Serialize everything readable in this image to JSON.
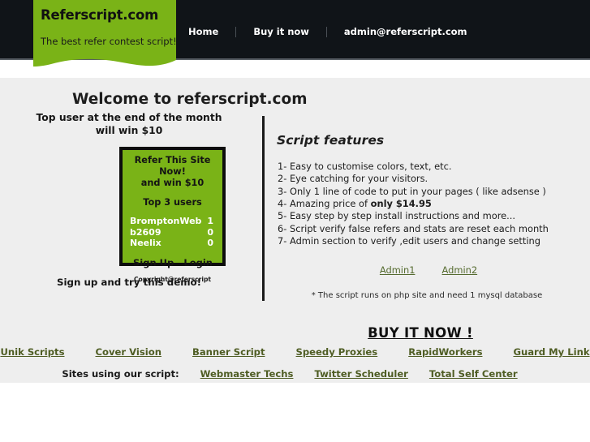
{
  "header": {
    "brand_title": "Referscript.com",
    "brand_tagline": "The best refer contest script!",
    "brand_color": "#7ab317",
    "bar_color": "#101418",
    "nav": [
      {
        "label": "Home"
      },
      {
        "label": "Buy it now"
      },
      {
        "label": "admin@referscript.com"
      }
    ]
  },
  "main": {
    "page_title": "Welcome to referscript.com",
    "left": {
      "promo_line1": "Top user at the end of the month",
      "promo_line2": "will win $10",
      "widget": {
        "title_line1": "Refer This Site Now!",
        "title_line2": "and win $10",
        "subtitle": "Top 3 users",
        "users": [
          {
            "name": "BromptonWeb",
            "score": "1"
          },
          {
            "name": "b2609",
            "score": "0"
          },
          {
            "name": "Neelix",
            "score": "0"
          }
        ],
        "signup_label": "Sign Up",
        "login_label": "Login",
        "copyright": "Copyright@referscript"
      },
      "demo_note": "Sign up and try this demo!"
    },
    "right": {
      "features_heading": "Script features",
      "features": [
        {
          "num": "1-",
          "text": "Easy to customise colors, text, etc."
        },
        {
          "num": "2-",
          "text": "Eye catching for your visitors."
        },
        {
          "num": "3-",
          "text": "Only 1 line of code to put in your pages ( like adsense )"
        },
        {
          "num": "4-",
          "text": "Amazing price of ",
          "bold": "only $14.95"
        },
        {
          "num": "5-",
          "text": "Easy step by step install instructions and more..."
        },
        {
          "num": "6-",
          "text": "Script verify false refers and  stats are reset each month"
        },
        {
          "num": "7-",
          "text": "Admin section to verify ,edit users and change setting"
        }
      ],
      "admin_links": [
        {
          "label": "Admin1"
        },
        {
          "label": "Admin2"
        }
      ],
      "db_note": "* The script runs on php site and need 1 mysql database",
      "buy_now_label": "BUY IT NOW !"
    }
  },
  "footer": {
    "link_color": "#4f5d24",
    "partner_links": [
      {
        "label": "Unik Scripts"
      },
      {
        "label": "Cover Vision"
      },
      {
        "label": "Banner Script"
      },
      {
        "label": "Speedy Proxies"
      },
      {
        "label": "RapidWorkers"
      },
      {
        "label": "Guard My Link"
      }
    ],
    "sites_label": "Sites using our script:",
    "site_links": [
      {
        "label": "Webmaster Techs"
      },
      {
        "label": "Twitter Scheduler"
      },
      {
        "label": "Total Self Center"
      }
    ]
  }
}
